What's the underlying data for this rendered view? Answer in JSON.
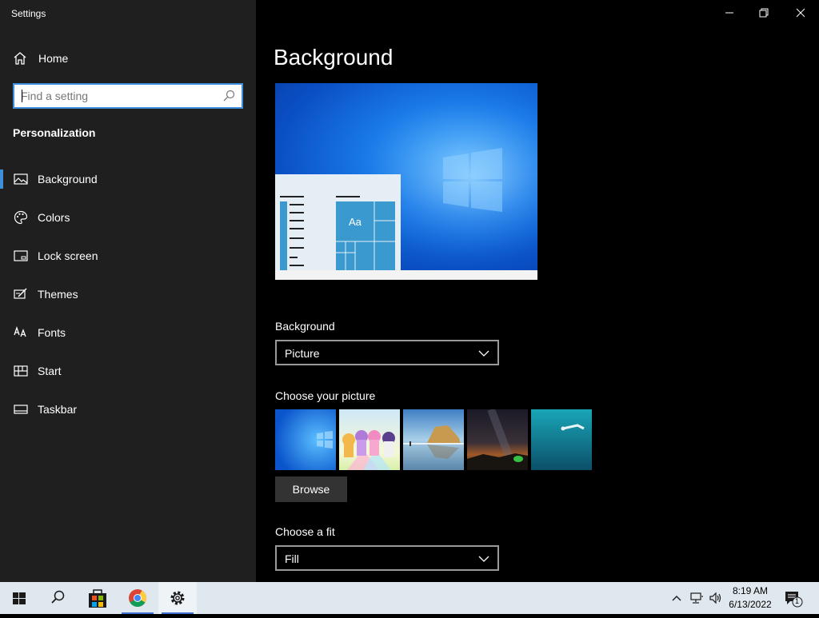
{
  "window": {
    "title": "Settings"
  },
  "sidebar": {
    "home_label": "Home",
    "search_placeholder": "Find a setting",
    "section_title": "Personalization",
    "items": [
      {
        "label": "Background"
      },
      {
        "label": "Colors"
      },
      {
        "label": "Lock screen"
      },
      {
        "label": "Themes"
      },
      {
        "label": "Fonts"
      },
      {
        "label": "Start"
      },
      {
        "label": "Taskbar"
      }
    ],
    "accent_color": "#3c8fd8"
  },
  "main": {
    "title": "Background",
    "preview_tile_text": "Aa",
    "background_label": "Background",
    "background_value": "Picture",
    "choose_picture_label": "Choose your picture",
    "browse_label": "Browse",
    "fit_label": "Choose a fit",
    "fit_value": "Fill"
  },
  "taskbar": {
    "time": "8:19 AM",
    "date": "6/13/2022",
    "notification_count": "1"
  }
}
